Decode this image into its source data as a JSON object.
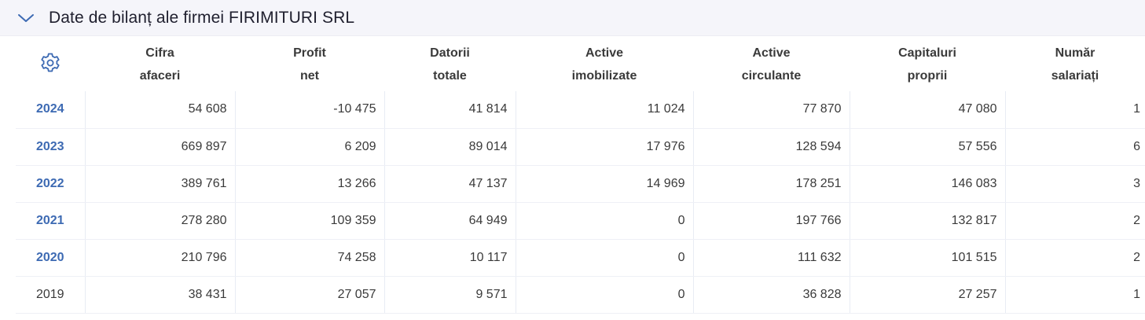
{
  "panel": {
    "title": "Date de bilanț ale firmei FIRIMITURI SRL",
    "toggle_icon": "chevron-down-icon",
    "settings_icon": "gear-icon"
  },
  "colors": {
    "accent": "#3d6ab3",
    "header_bg": "#f5f5fa",
    "text": "#3a3a3a"
  },
  "table": {
    "headers": [
      [
        "Cifra",
        "afaceri"
      ],
      [
        "Profit",
        "net"
      ],
      [
        "Datorii",
        "totale"
      ],
      [
        "Active",
        "imobilizate"
      ],
      [
        "Active",
        "circulante"
      ],
      [
        "Capitaluri",
        "proprii"
      ],
      [
        "Număr",
        "salariați"
      ]
    ],
    "rows": [
      {
        "year": "2024",
        "link": true,
        "values": [
          "54 608",
          "-10 475",
          "41 814",
          "11 024",
          "77 870",
          "47 080",
          "1"
        ]
      },
      {
        "year": "2023",
        "link": true,
        "values": [
          "669 897",
          "6 209",
          "89 014",
          "17 976",
          "128 594",
          "57 556",
          "6"
        ]
      },
      {
        "year": "2022",
        "link": true,
        "values": [
          "389 761",
          "13 266",
          "47 137",
          "14 969",
          "178 251",
          "146 083",
          "3"
        ]
      },
      {
        "year": "2021",
        "link": true,
        "values": [
          "278 280",
          "109 359",
          "64 949",
          "0",
          "197 766",
          "132 817",
          "2"
        ]
      },
      {
        "year": "2020",
        "link": true,
        "values": [
          "210 796",
          "74 258",
          "10 117",
          "0",
          "111 632",
          "101 515",
          "2"
        ]
      },
      {
        "year": "2019",
        "link": false,
        "values": [
          "38 431",
          "27 057",
          "9 571",
          "0",
          "36 828",
          "27 257",
          "1"
        ]
      }
    ]
  }
}
